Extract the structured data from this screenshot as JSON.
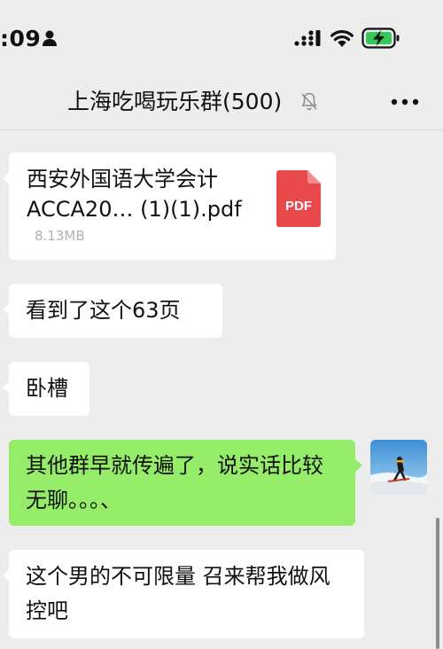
{
  "status_bar": {
    "time": ":09",
    "icons": [
      "person-icon",
      "signal-icon",
      "wifi-icon",
      "battery-charging-icon"
    ]
  },
  "header": {
    "title": "上海吃喝玩乐群(500)",
    "icons": [
      "mute-bell-icon",
      "more-icon"
    ]
  },
  "messages": [
    {
      "type": "file",
      "side": "left",
      "file_name": "西安外国语大学会计ACCA20… (1)(1).pdf",
      "file_size": "8.13MB",
      "icon": "pdf-file-icon",
      "icon_label": "PDF"
    },
    {
      "type": "text",
      "side": "left",
      "text": "看到了这个63页"
    },
    {
      "type": "text",
      "side": "left",
      "text": "卧槽"
    },
    {
      "type": "text",
      "side": "right",
      "text": "其他群早就传遍了，说实话比较无聊。。。、"
    },
    {
      "type": "text",
      "side": "left",
      "text": "这个男的不可限量 召来帮我做风控吧"
    }
  ],
  "colors": {
    "background": "#ededed",
    "incoming_bubble": "#ffffff",
    "outgoing_bubble": "#95ec69",
    "pdf_red": "#e8494b",
    "battery_green": "#34c759"
  }
}
